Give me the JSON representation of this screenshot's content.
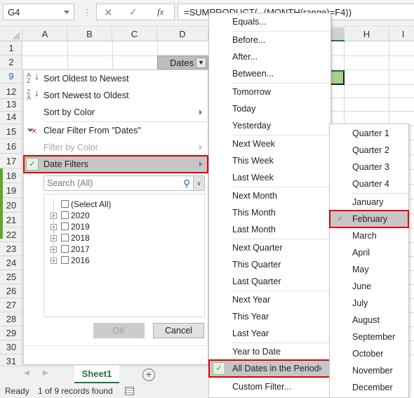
{
  "formula_bar": {
    "name_box": "G4",
    "cancel_icon": "close-icon",
    "enter_icon": "check-icon",
    "fx_label": "fx",
    "formula": "=SUMPRODUCT(--(MONTH(range)=F4))"
  },
  "grid": {
    "columns": [
      "A",
      "B",
      "C",
      "D",
      "",
      "",
      "H",
      "I"
    ],
    "rows": [
      "1",
      "2",
      "9",
      "12",
      "13",
      "14",
      "15",
      "16",
      "17",
      "18",
      "19",
      "20",
      "21",
      "22",
      "23",
      "24",
      "25",
      "26",
      "27",
      "28",
      "29",
      "30",
      "31"
    ],
    "d2_header": "Dates"
  },
  "filter_panel": {
    "items": [
      {
        "label": "Sort Oldest to Newest",
        "icon": "sort-ascending-icon"
      },
      {
        "label": "Sort Newest to Oldest",
        "icon": "sort-descending-icon"
      },
      {
        "label": "Sort by Color"
      },
      {
        "label": "Clear Filter From \"Dates\"",
        "icon": "clear-filter-icon"
      },
      {
        "label": "Filter by Color"
      },
      {
        "label": "Date Filters"
      }
    ],
    "search_placeholder": "Search (All)",
    "tree": [
      "(Select All)",
      "2020",
      "2019",
      "2018",
      "2017",
      "2016"
    ],
    "ok": "OK",
    "cancel": "Cancel"
  },
  "date_filters_menu": {
    "items": [
      "Equals...",
      "Before...",
      "After...",
      "Between...",
      "Tomorrow",
      "Today",
      "Yesterday",
      "Next Week",
      "This Week",
      "Last Week",
      "Next Month",
      "This Month",
      "Last Month",
      "Next Quarter",
      "This Quarter",
      "Last Quarter",
      "Next Year",
      "This Year",
      "Last Year",
      "Year to Date",
      "All Dates in the Period",
      "Custom Filter..."
    ]
  },
  "period_menu": {
    "items": [
      "Quarter 1",
      "Quarter 2",
      "Quarter 3",
      "Quarter 4",
      "January",
      "February",
      "March",
      "April",
      "May",
      "June",
      "July",
      "August",
      "September",
      "October",
      "November",
      "December"
    ],
    "selected": "February"
  },
  "sheet_tabs": {
    "active": "Sheet1",
    "add_icon": "plus-circle-icon"
  },
  "status_bar": {
    "ready": "Ready",
    "records": "1 of 9 records found"
  }
}
